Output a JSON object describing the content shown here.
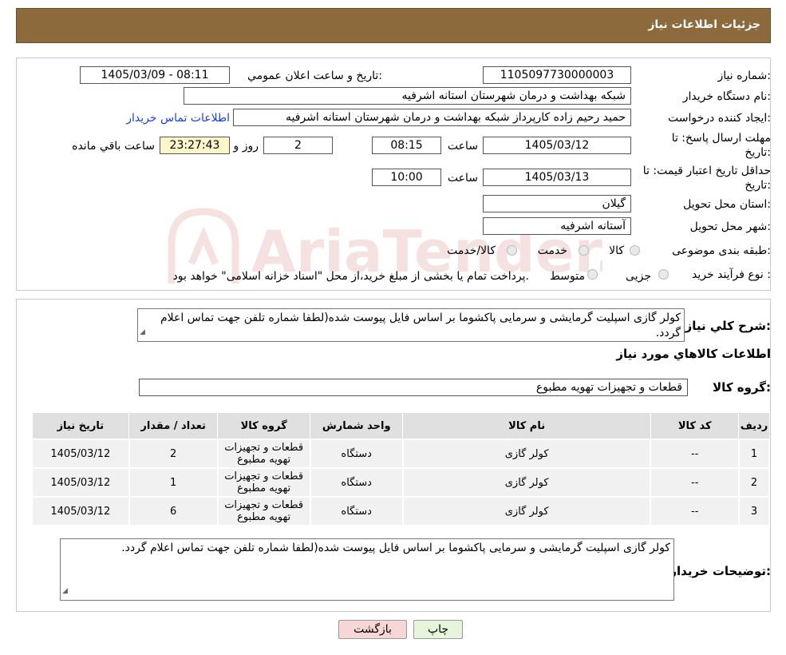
{
  "header": {
    "title": "جزئیات اطلاعات نیاز"
  },
  "form": {
    "need_number_label": "شماره نیاز:",
    "need_number": "1105097730000003",
    "announce_label": "تاریخ و ساعت اعلان عمومي:",
    "announce_value": "1405/03/09 - 08:11",
    "buyer_org_label": "نام دستگاه خریدار:",
    "buyer_org": "شبکه بهداشت و درمان شهرستان استانه اشرفیه",
    "creator_label": "ایجاد کننده درخواست:",
    "creator": "حمید رحیم زاده کارپرداز شبکه بهداشت و درمان شهرستان استانه اشرفیه",
    "contact_link": "اطلاعات تماس خریدار",
    "deadline_label_1": "مهلت ارسال پاسخ: تا",
    "deadline_label_2": "تاریخ:",
    "deadline_date": "1405/03/12",
    "time_label": "ساعت",
    "deadline_time": "08:15",
    "days_value": "2",
    "days_label": "روز و",
    "remaining_time": "23:27:43",
    "remaining_label": "ساعت باقي مانده",
    "validity_label_1": "حداقل تاریخ اعتبار قیمت: تا",
    "validity_label_2": "تاریخ:",
    "validity_date": "1405/03/13",
    "validity_time": "10:00",
    "province_label": "استان محل تحویل:",
    "province": "گیلان",
    "city_label": "شهر محل تحویل:",
    "city": "آستانه اشرفیه",
    "category_label": "طبقه بندی موضوعی:",
    "category_options": [
      "کالا",
      "خدمت",
      "کالا/خدمت"
    ],
    "process_label": "نوع فرآیند خرید :",
    "process_options": [
      "جزیی",
      "متوسط"
    ],
    "process_note": "پرداخت تمام یا بخشی از مبلغ خرید،از محل \"اسناد خزانه اسلامی\" خواهد بود."
  },
  "summary": {
    "label": "شرح کلي نياز:",
    "text": "کولر گازی اسپلیت گرمایشی و سرمایی پاکشوما بر اساس فایل پیوست شده(لطفا شماره تلفن جهت تماس اعلام گردد.",
    "goods_info_title": "اطلاعات کالاهاي مورد نياز",
    "group_label": "گروه کالا:",
    "group_value": "قطعات و تجهیزات تهویه مطبوع"
  },
  "table": {
    "headers": [
      "رديف",
      "کد کالا",
      "نام کالا",
      "واحد شمارش",
      "گروه کالا",
      "تعداد / مقدار",
      "تاریخ نیاز"
    ],
    "rows": [
      [
        "1",
        "--",
        "کولر گازی",
        "دستگاه",
        "قطعات و تجهیزات تهویه مطبوع",
        "2",
        "1405/03/12"
      ],
      [
        "2",
        "--",
        "کولر گازی",
        "دستگاه",
        "قطعات و تجهیزات تهویه مطبوع",
        "1",
        "1405/03/12"
      ],
      [
        "3",
        "--",
        "کولر گازی",
        "دستگاه",
        "قطعات و تجهیزات تهویه مطبوع",
        "6",
        "1405/03/12"
      ]
    ]
  },
  "buyer_notes": {
    "label": "توضیحات خریدار:",
    "text": "کولر گازی اسپلیت گرمایشی و سرمایی پاکشوما بر اساس فایل پیوست شده(لطفا شماره تلفن جهت تماس اعلام گردد."
  },
  "buttons": {
    "print": "چاپ",
    "back": "بازگشت"
  },
  "watermark": "AriaTender.neT",
  "colors": {
    "header_bg": "#8c6a3c",
    "link": "#1a3fd6",
    "back_btn_bg": "#f7d6d6",
    "print_btn_bg": "#e5f5dc"
  }
}
